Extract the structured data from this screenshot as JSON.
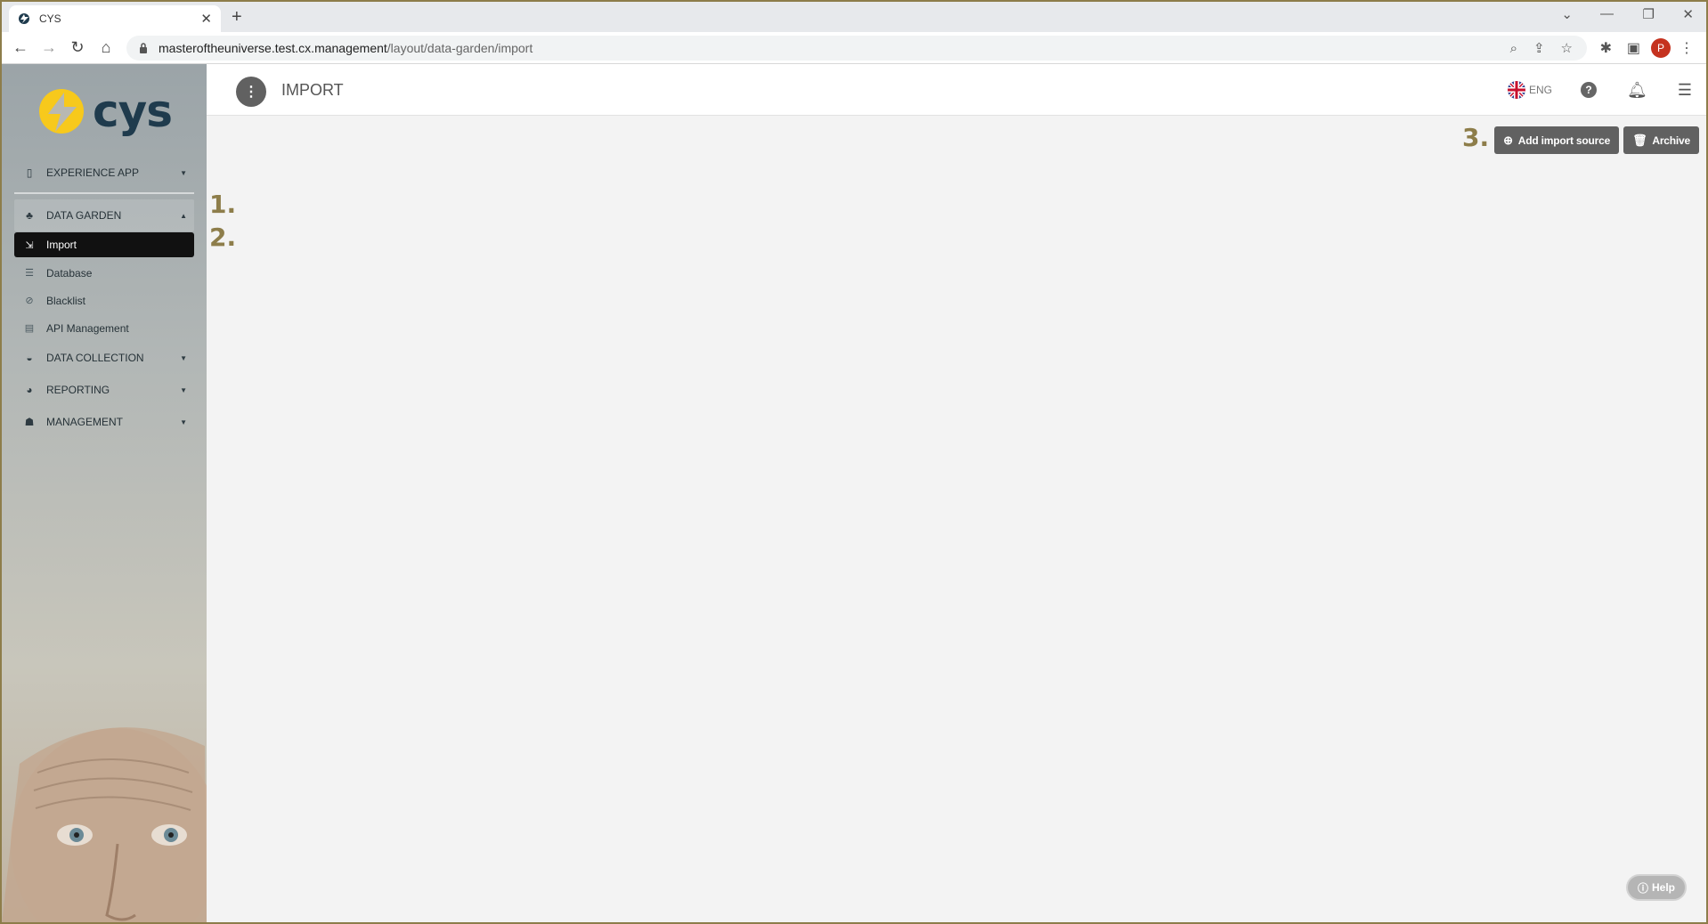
{
  "browser": {
    "tab_title": "CYS",
    "tab_close": "✕",
    "new_tab": "+",
    "url_host": "masteroftheuniverse.test.cx.management",
    "url_path": "/layout/data-garden/import",
    "profile_initial": "P"
  },
  "sidebar": {
    "logo_text": "cys",
    "groups": [
      {
        "label": "EXPERIENCE APP",
        "icon": "phone-icon"
      },
      {
        "label": "DATA GARDEN",
        "icon": "tree-icon",
        "expanded": true
      },
      {
        "label": "DATA COLLECTION",
        "icon": "inbox-icon"
      },
      {
        "label": "REPORTING",
        "icon": "pie-chart-icon"
      },
      {
        "label": "MANAGEMENT",
        "icon": "user-icon"
      }
    ],
    "data_garden_items": [
      {
        "label": "Import",
        "icon": "import-icon",
        "active": true
      },
      {
        "label": "Database",
        "icon": "database-icon"
      },
      {
        "label": "Blacklist",
        "icon": "ban-icon"
      },
      {
        "label": "API Management",
        "icon": "file-icon"
      }
    ]
  },
  "header": {
    "title": "IMPORT",
    "language": "ENG"
  },
  "actions": {
    "add_import_source": "Add import source",
    "archive": "Archive"
  },
  "annotations": {
    "one": "1.",
    "two": "2.",
    "three": "3."
  },
  "help_label": "Help",
  "colors": {
    "accent": "#616161",
    "logo_yellow": "#f7c91c",
    "logo_dark": "#1f3b4d",
    "annotation": "#8d7d4a"
  }
}
